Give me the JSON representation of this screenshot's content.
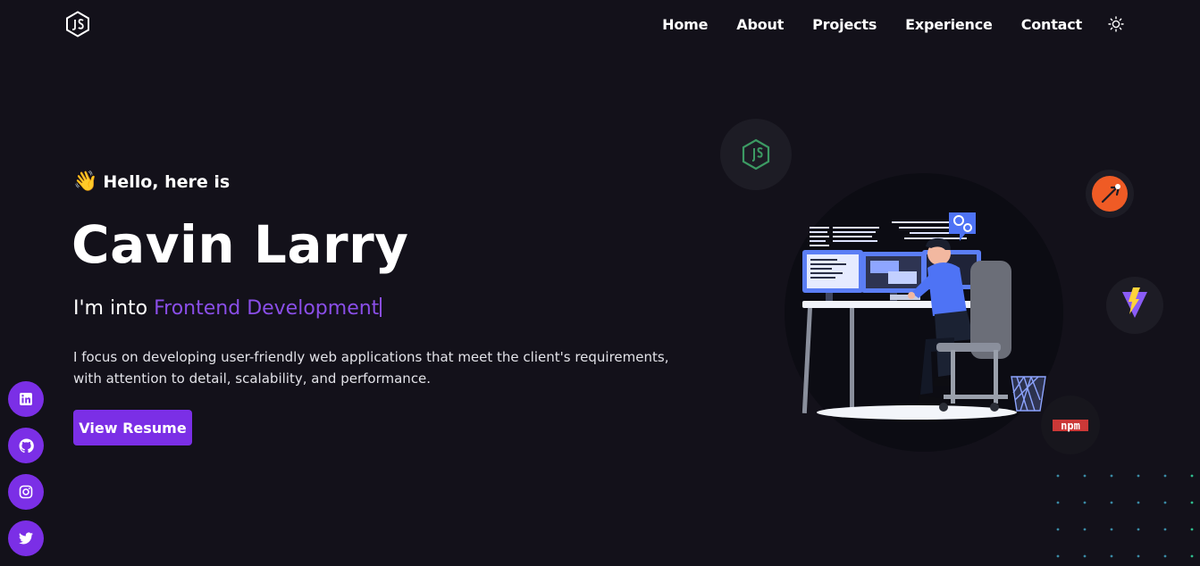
{
  "nav": {
    "links": [
      "Home",
      "About",
      "Projects",
      "Experience",
      "Contact"
    ]
  },
  "hero": {
    "greeting_emoji": "👋",
    "greeting": "Hello, here is",
    "name": "Cavin Larry",
    "role_prefix": "I'm into ",
    "role_highlight": "Frontend Development",
    "description": "I focus on developing user-friendly web applications that meet the client's requirements, with attention to detail, scalability, and performance.",
    "resume_button": "View Resume"
  },
  "floating_icons": {
    "npm_label": "npm"
  },
  "colors": {
    "background": "#13111a",
    "accent": "#7b2fe6",
    "highlight_text": "#8a4ee8",
    "node_green": "#3c9a63",
    "postman_orange": "#ef5b25"
  }
}
